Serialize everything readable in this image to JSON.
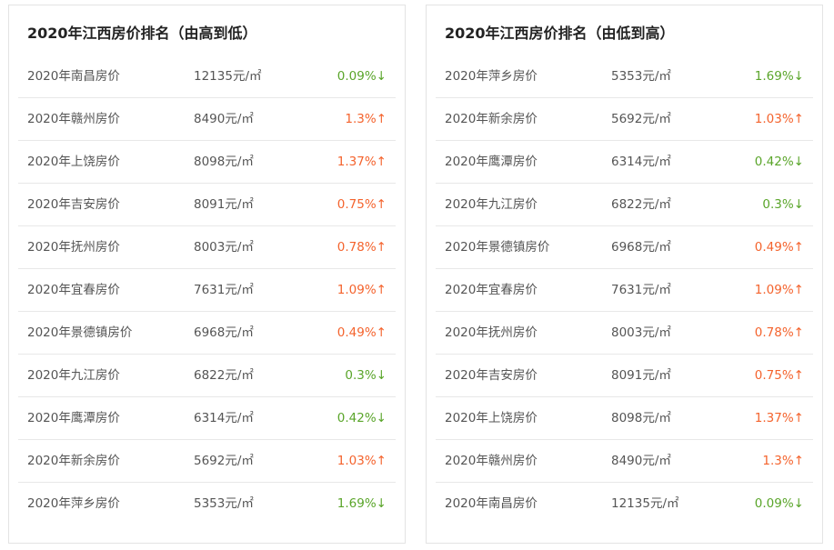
{
  "left": {
    "title": "2020年江西房价排名（由高到低）",
    "rows": [
      {
        "city": "2020年南昌房价",
        "price": "12135元/㎡",
        "change": "0.09%↓",
        "dir": "down"
      },
      {
        "city": "2020年赣州房价",
        "price": "8490元/㎡",
        "change": "1.3%↑",
        "dir": "up"
      },
      {
        "city": "2020年上饶房价",
        "price": "8098元/㎡",
        "change": "1.37%↑",
        "dir": "up"
      },
      {
        "city": "2020年吉安房价",
        "price": "8091元/㎡",
        "change": "0.75%↑",
        "dir": "up"
      },
      {
        "city": "2020年抚州房价",
        "price": "8003元/㎡",
        "change": "0.78%↑",
        "dir": "up"
      },
      {
        "city": "2020年宜春房价",
        "price": "7631元/㎡",
        "change": "1.09%↑",
        "dir": "up"
      },
      {
        "city": "2020年景德镇房价",
        "price": "6968元/㎡",
        "change": "0.49%↑",
        "dir": "up"
      },
      {
        "city": "2020年九江房价",
        "price": "6822元/㎡",
        "change": "0.3%↓",
        "dir": "down"
      },
      {
        "city": "2020年鹰潭房价",
        "price": "6314元/㎡",
        "change": "0.42%↓",
        "dir": "down"
      },
      {
        "city": "2020年新余房价",
        "price": "5692元/㎡",
        "change": "1.03%↑",
        "dir": "up"
      },
      {
        "city": "2020年萍乡房价",
        "price": "5353元/㎡",
        "change": "1.69%↓",
        "dir": "down"
      }
    ]
  },
  "right": {
    "title": "2020年江西房价排名（由低到高）",
    "rows": [
      {
        "city": "2020年萍乡房价",
        "price": "5353元/㎡",
        "change": "1.69%↓",
        "dir": "down"
      },
      {
        "city": "2020年新余房价",
        "price": "5692元/㎡",
        "change": "1.03%↑",
        "dir": "up"
      },
      {
        "city": "2020年鹰潭房价",
        "price": "6314元/㎡",
        "change": "0.42%↓",
        "dir": "down"
      },
      {
        "city": "2020年九江房价",
        "price": "6822元/㎡",
        "change": "0.3%↓",
        "dir": "down"
      },
      {
        "city": "2020年景德镇房价",
        "price": "6968元/㎡",
        "change": "0.49%↑",
        "dir": "up"
      },
      {
        "city": "2020年宜春房价",
        "price": "7631元/㎡",
        "change": "1.09%↑",
        "dir": "up"
      },
      {
        "city": "2020年抚州房价",
        "price": "8003元/㎡",
        "change": "0.78%↑",
        "dir": "up"
      },
      {
        "city": "2020年吉安房价",
        "price": "8091元/㎡",
        "change": "0.75%↑",
        "dir": "up"
      },
      {
        "city": "2020年上饶房价",
        "price": "8098元/㎡",
        "change": "1.37%↑",
        "dir": "up"
      },
      {
        "city": "2020年赣州房价",
        "price": "8490元/㎡",
        "change": "1.3%↑",
        "dir": "up"
      },
      {
        "city": "2020年南昌房价",
        "price": "12135元/㎡",
        "change": "0.09%↓",
        "dir": "down"
      }
    ]
  },
  "colors": {
    "up": "#f4632d",
    "down": "#5aa52a"
  }
}
